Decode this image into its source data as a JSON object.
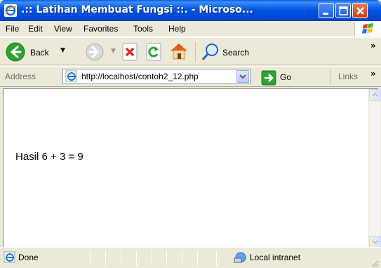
{
  "window": {
    "title": ".:: Latihan Membuat Fungsi ::. - Microso...",
    "title_icon": "ie-icon",
    "controls": [
      "minimize-icon",
      "maximize-icon",
      "close-icon"
    ]
  },
  "menubar": {
    "items": [
      {
        "label": "File"
      },
      {
        "label": "Edit"
      },
      {
        "label": "View"
      },
      {
        "label": "Favorites"
      },
      {
        "label": "Tools"
      },
      {
        "label": "Help"
      }
    ]
  },
  "toolbar": {
    "back_label": "Back",
    "search_label": "Search",
    "icons": [
      "back-icon",
      "forward-icon",
      "stop-icon",
      "refresh-icon",
      "home-icon",
      "search-icon"
    ]
  },
  "addressbar": {
    "label": "Address",
    "url": "http://localhost/contoh2_12.php",
    "go_label": "Go",
    "links_label": "Links"
  },
  "content": {
    "text": "Hasil 6 + 3 = 9"
  },
  "statusbar": {
    "status": "Done",
    "zone": "Local intranet"
  },
  "colors": {
    "titlebar": "#0055E5",
    "chrome": "#ECE9D8",
    "close_button": "#C4401C",
    "back_arrow": "#2FA12F",
    "go_arrow": "#2FA12F"
  }
}
